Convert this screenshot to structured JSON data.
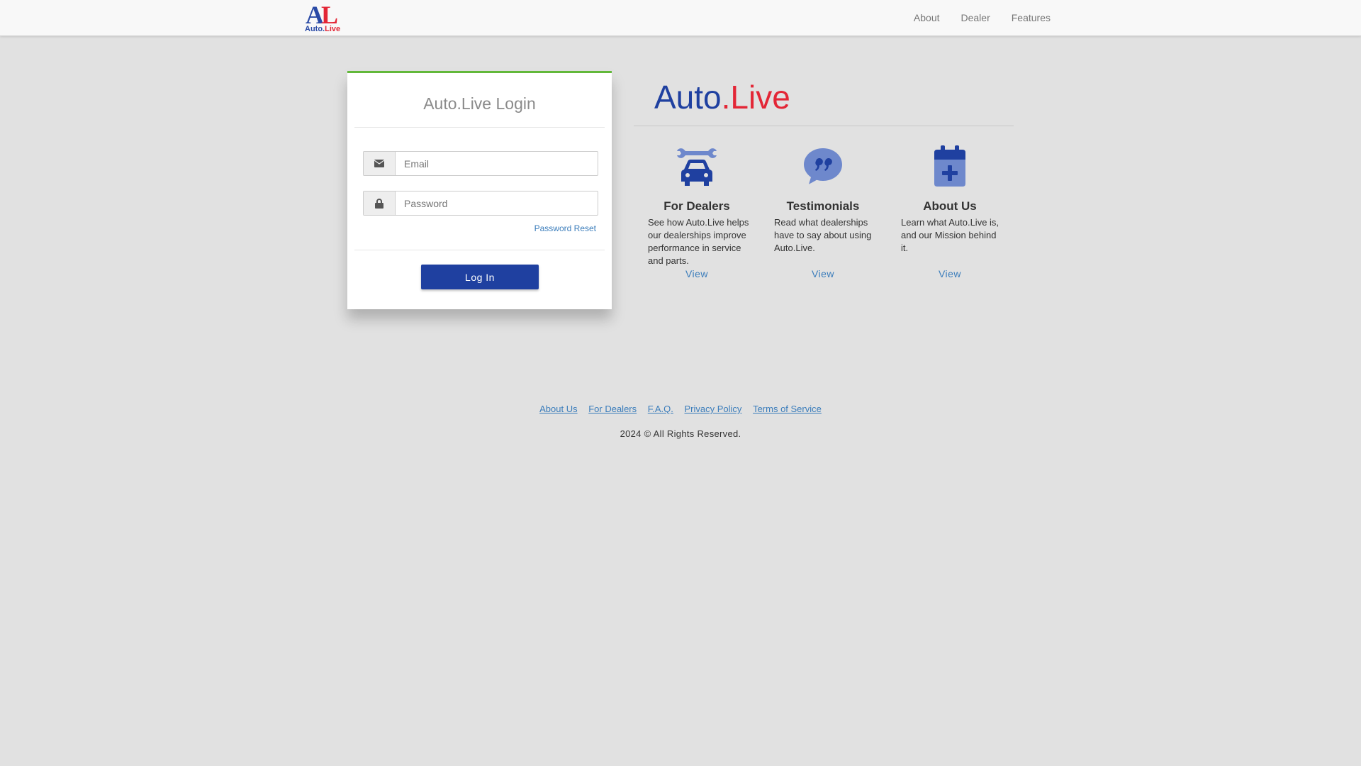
{
  "nav": {
    "logo_big_a": "A",
    "logo_big_l": "L",
    "logo_text_part1": "Auto.",
    "logo_text_part2": "Live",
    "links": [
      "About",
      "Dealer",
      "Features"
    ]
  },
  "login": {
    "title": "Auto.Live Login",
    "email_placeholder": "Email",
    "password_placeholder": "Password",
    "password_reset": "Password Reset",
    "login_button": "Log In"
  },
  "brand": {
    "part1": "Auto",
    "part2": ".Live"
  },
  "features": [
    {
      "title": "For Dealers",
      "desc": "See how Auto.Live helps our dealerships improve performance in service and parts.",
      "link": "View",
      "icon": "car-wrench-icon"
    },
    {
      "title": "Testimonials",
      "desc": "Read what dealerships have to say about using Auto.Live.",
      "link": "View",
      "icon": "quote-bubble-icon"
    },
    {
      "title": "About Us",
      "desc": "Learn what Auto.Live is, and our Mission behind it.",
      "link": "View",
      "icon": "calendar-plus-icon"
    }
  ],
  "footer": {
    "links": [
      "About Us",
      "For Dealers",
      "F.A.Q.",
      "Privacy Policy",
      "Terms of Service"
    ],
    "copyright": "2024 © All Rights Reserved."
  },
  "colors": {
    "primary_blue": "#1f40a0",
    "brand_red": "#e32636",
    "link_blue": "#3b7dbb",
    "panel_top_border": "#62b83a",
    "icon_blue_light": "#6e88cc"
  }
}
